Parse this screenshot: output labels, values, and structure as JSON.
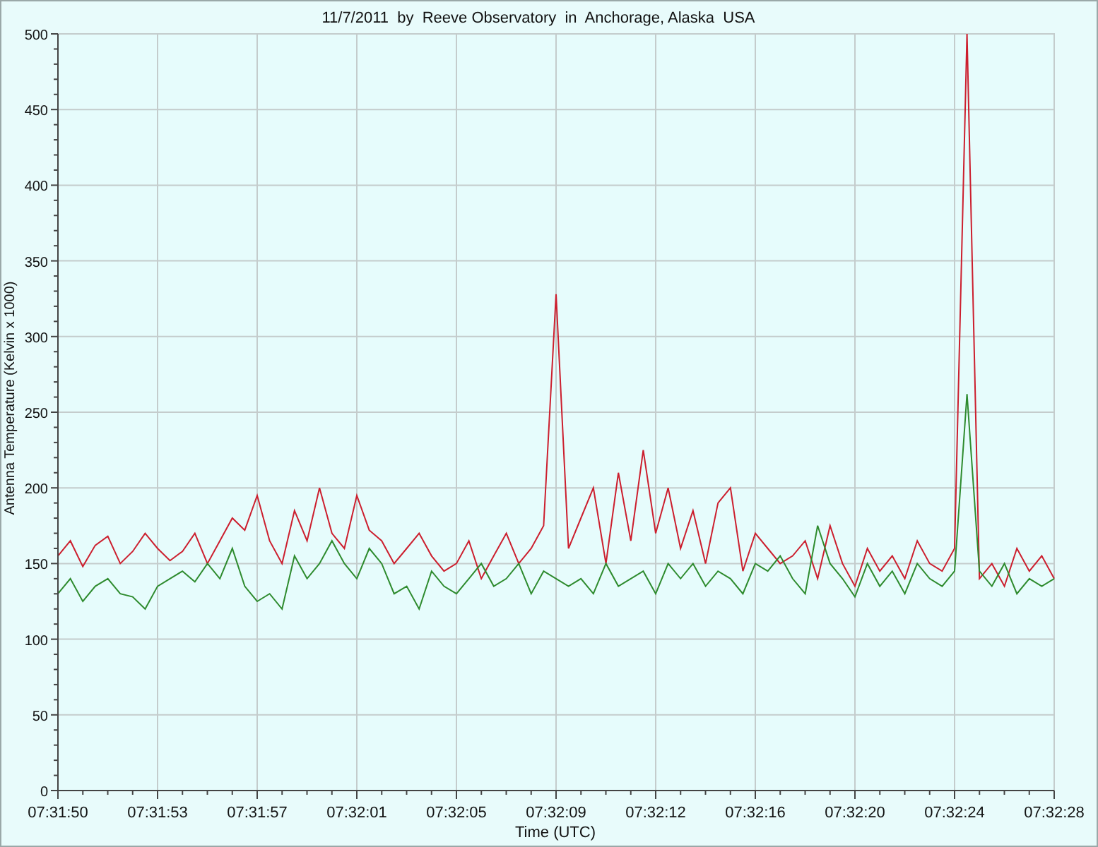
{
  "chart_data": {
    "type": "line",
    "title": "11/7/2011  by  Reeve Observatory  in  Anchorage, Alaska  USA",
    "xlabel": "Time (UTC)",
    "ylabel": "Antenna Temperature (Kelvin x 1000)",
    "categories": [
      "07:31:50",
      null,
      null,
      null,
      null,
      null,
      null,
      null,
      "07:31:53",
      null,
      null,
      null,
      null,
      null,
      null,
      null,
      "07:31:57",
      null,
      null,
      null,
      null,
      null,
      null,
      null,
      "07:32:01",
      null,
      null,
      null,
      null,
      null,
      null,
      null,
      "07:32:05",
      null,
      null,
      null,
      null,
      null,
      null,
      null,
      "07:32:09",
      null,
      null,
      null,
      null,
      null,
      null,
      null,
      "07:32:12",
      null,
      null,
      null,
      null,
      null,
      null,
      null,
      "07:32:16",
      null,
      null,
      null,
      null,
      null,
      null,
      null,
      "07:32:20",
      null,
      null,
      null,
      null,
      null,
      null,
      null,
      "07:32:24",
      null,
      null,
      null,
      null,
      null,
      null,
      null,
      "07:32:28"
    ],
    "series": [
      {
        "color": "#cc1f2e",
        "values": [
          155,
          165,
          148,
          162,
          168,
          150,
          158,
          170,
          160,
          152,
          158,
          170,
          150,
          165,
          180,
          172,
          195,
          165,
          150,
          185,
          165,
          200,
          170,
          160,
          195,
          172,
          165,
          150,
          160,
          170,
          155,
          145,
          150,
          165,
          140,
          155,
          170,
          150,
          160,
          175,
          328,
          160,
          180,
          200,
          150,
          210,
          165,
          225,
          170,
          200,
          160,
          185,
          150,
          190,
          200,
          145,
          170,
          160,
          150,
          155,
          165,
          140,
          175,
          150,
          135,
          160,
          145,
          155,
          140,
          165,
          150,
          145,
          160,
          500,
          140,
          150,
          135,
          160,
          145,
          155,
          140
        ]
      },
      {
        "color": "#2e8b2e",
        "values": [
          130,
          140,
          125,
          135,
          140,
          130,
          128,
          120,
          135,
          140,
          145,
          138,
          150,
          140,
          160,
          135,
          125,
          130,
          120,
          155,
          140,
          150,
          165,
          150,
          140,
          160,
          150,
          130,
          135,
          120,
          145,
          135,
          130,
          140,
          150,
          135,
          140,
          150,
          130,
          145,
          140,
          135,
          140,
          130,
          150,
          135,
          140,
          145,
          130,
          150,
          140,
          150,
          135,
          145,
          140,
          130,
          150,
          145,
          155,
          140,
          130,
          175,
          150,
          140,
          128,
          150,
          135,
          145,
          130,
          150,
          140,
          135,
          145,
          262,
          145,
          135,
          150,
          130,
          140,
          135,
          140
        ]
      }
    ],
    "grid": true,
    "ylim": [
      0,
      500
    ],
    "yticks": [
      0,
      50,
      100,
      150,
      200,
      250,
      300,
      350,
      400,
      450,
      500
    ]
  }
}
